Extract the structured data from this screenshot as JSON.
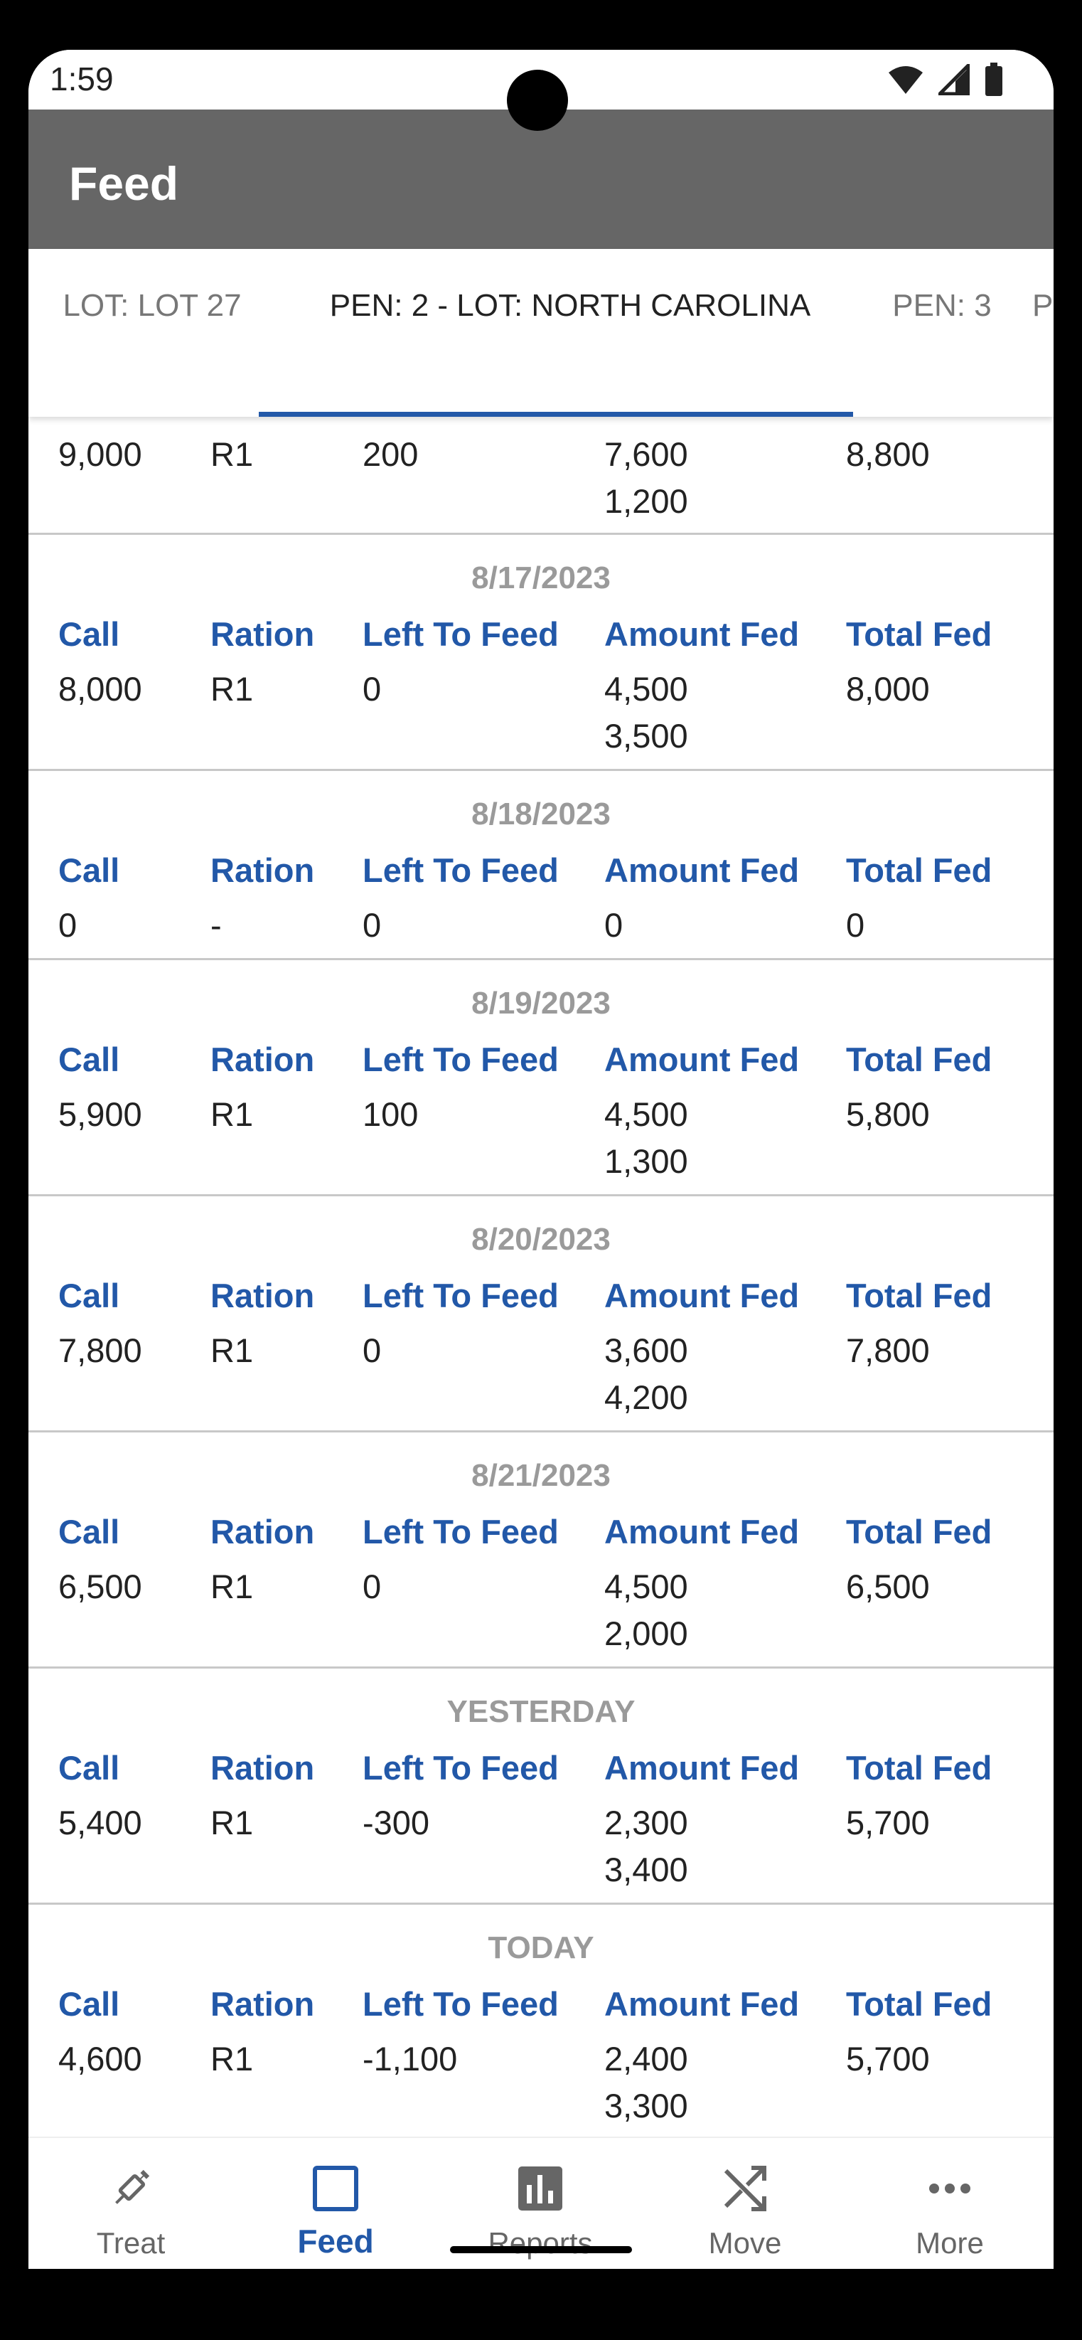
{
  "status_bar": {
    "time": "1:59"
  },
  "app_bar": {
    "title": "Feed"
  },
  "tabs": [
    {
      "label": "LOT: LOT 27"
    },
    {
      "label": "PEN: 2 - LOT: NORTH CAROLINA"
    },
    {
      "label": "PEN: 3"
    },
    {
      "label": "P"
    }
  ],
  "columns": {
    "call": "Call",
    "ration": "Ration",
    "left": "Left To Feed",
    "amount": "Amount Fed",
    "total": "Total Fed"
  },
  "partial_entry": {
    "call": "9,000",
    "ration": "R1",
    "left": "200",
    "amount": [
      "7,600",
      "1,200"
    ],
    "total": "8,800"
  },
  "entries": [
    {
      "date": "8/17/2023",
      "call": "8,000",
      "ration": "R1",
      "left": "0",
      "amount": [
        "4,500",
        "3,500"
      ],
      "total": "8,000"
    },
    {
      "date": "8/18/2023",
      "call": "0",
      "ration": "-",
      "left": "0",
      "amount": [
        "0"
      ],
      "total": "0"
    },
    {
      "date": "8/19/2023",
      "call": "5,900",
      "ration": "R1",
      "left": "100",
      "amount": [
        "4,500",
        "1,300"
      ],
      "total": "5,800"
    },
    {
      "date": "8/20/2023",
      "call": "7,800",
      "ration": "R1",
      "left": "0",
      "amount": [
        "3,600",
        "4,200"
      ],
      "total": "7,800"
    },
    {
      "date": "8/21/2023",
      "call": "6,500",
      "ration": "R1",
      "left": "0",
      "amount": [
        "4,500",
        "2,000"
      ],
      "total": "6,500"
    },
    {
      "date": "YESTERDAY",
      "call": "5,400",
      "ration": "R1",
      "left": "-300",
      "amount": [
        "2,300",
        "3,400"
      ],
      "total": "5,700"
    },
    {
      "date": "TODAY",
      "call": "4,600",
      "ration": "R1",
      "left": "-1,100",
      "amount": [
        "2,400",
        "3,300"
      ],
      "total": "5,700"
    }
  ],
  "bottom_nav": [
    {
      "label": "Treat",
      "icon": "syringe-icon"
    },
    {
      "label": "Feed",
      "icon": "feed-square-icon"
    },
    {
      "label": "Reports",
      "icon": "bar-chart-icon"
    },
    {
      "label": "Move",
      "icon": "shuffle-icon"
    },
    {
      "label": "More",
      "icon": "more-horizontal-icon"
    }
  ],
  "colors": {
    "accent": "#2258a8",
    "app_bar": "#666666",
    "date_text": "#9a9a9a"
  }
}
